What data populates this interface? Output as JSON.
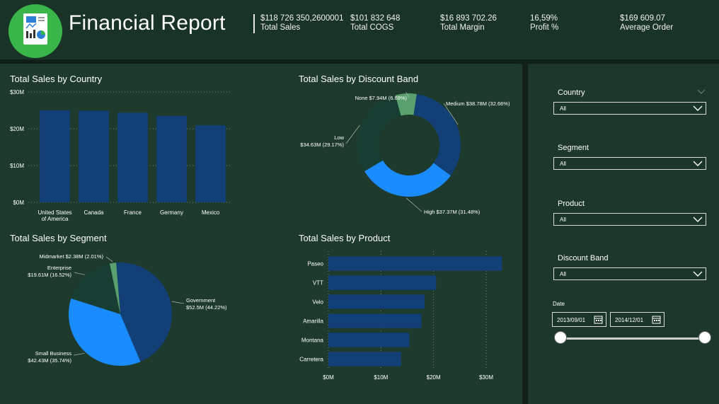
{
  "header": {
    "title": "Financial Report",
    "kpis": [
      {
        "value": "$118 726 350,2600001",
        "label": "Total Sales"
      },
      {
        "value": "$101 832 648",
        "label": "Total COGS"
      },
      {
        "value": "$16 893 702.26",
        "label": "Total Margin"
      },
      {
        "value": "16,59%",
        "label": "Profit %"
      },
      {
        "value": "$169 609.07",
        "label": "Average Order"
      }
    ]
  },
  "colors": {
    "bar": "#123f76",
    "dark": "#183d32",
    "blue": "#1a8cff",
    "green": "#5aa06f"
  },
  "charts": {
    "country": {
      "title": "Total Sales by Country"
    },
    "discount": {
      "title": "Total Sales by Discount Band"
    },
    "segment": {
      "title": "Total Sales by Segment"
    },
    "product": {
      "title": "Total Sales by Product"
    }
  },
  "chart_data": [
    {
      "type": "bar",
      "title": "Total Sales by Country",
      "categories": [
        "United States of America",
        "Canada",
        "France",
        "Germany",
        "Mexico"
      ],
      "values": [
        25.03,
        24.89,
        24.35,
        23.51,
        20.95
      ],
      "yticks": [
        "$0M",
        "$10M",
        "$20M",
        "$30M"
      ],
      "ylim": [
        0,
        30
      ],
      "grid": true
    },
    {
      "type": "pie",
      "variant": "donut",
      "title": "Total Sales by Discount Band",
      "slices": [
        {
          "label": "None",
          "value": 7.94,
          "text": "None $7.94M (6.69%)"
        },
        {
          "label": "Medium",
          "value": 38.78,
          "text": "Medium $38.78M (32.66%)"
        },
        {
          "label": "High",
          "value": 37.37,
          "text": "High $37.37M (31.48%)"
        },
        {
          "label": "Low",
          "value": 34.63,
          "text_line1": "Low",
          "text_line2": "$34.63M (29.17%)"
        }
      ]
    },
    {
      "type": "pie",
      "title": "Total Sales by Segment",
      "slices": [
        {
          "label": "Government",
          "value": 52.5,
          "text_line1": "Government",
          "text_line2": "$52.5M (44.22%)"
        },
        {
          "label": "Small Business",
          "value": 42.43,
          "text_line1": "Small Business",
          "text_line2": "$42.43M (35.74%)"
        },
        {
          "label": "Enterprise",
          "value": 19.61,
          "text_line1": "Enterprise",
          "text_line2": "$19.61M (16.52%)"
        },
        {
          "label": "Midmarket",
          "value": 2.38,
          "text": "Midmarket $2.38M (2.01%)"
        }
      ]
    },
    {
      "type": "bar",
      "orientation": "horizontal",
      "title": "Total Sales by Product",
      "categories": [
        "Paseo",
        "VTT",
        "Velo",
        "Amarilla",
        "Montana",
        "Carretera"
      ],
      "values": [
        33.0,
        20.5,
        18.3,
        17.7,
        15.4,
        13.8
      ],
      "xticks": [
        "$0M",
        "$10M",
        "$20M",
        "$30M"
      ],
      "xlim": [
        0,
        30
      ],
      "grid": true
    }
  ],
  "slicers": [
    {
      "label": "Country",
      "value": "All"
    },
    {
      "label": "Segment",
      "value": "All"
    },
    {
      "label": "Product",
      "value": "All"
    },
    {
      "label": "Discount Band",
      "value": "All"
    }
  ],
  "date": {
    "label": "Date",
    "start": "2013/09/01",
    "end": "2014/12/01"
  }
}
